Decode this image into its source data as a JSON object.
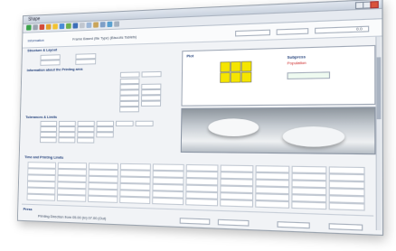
{
  "window": {
    "title": "Shape"
  },
  "header": {
    "left_label": "Information",
    "description": "Frame Based (file Type) (Biscuits Tablets)",
    "right_value": "0.0"
  },
  "left_panel": {
    "section1_title": "Structure & Layout",
    "section2_title": "Information about the Printing area",
    "section3_title": "Tolerances & Limits"
  },
  "plot": {
    "title": "Plot",
    "legend_title": "Subpress",
    "legend_item": "Population",
    "grid_count": 6,
    "grid_color": "#f5e500"
  },
  "table": {
    "title": "Time and Printing Limits"
  },
  "bottom": {
    "title": "Press",
    "footer_text": "Printing Direction from 05.00 (In) 07.00 (Out)"
  }
}
